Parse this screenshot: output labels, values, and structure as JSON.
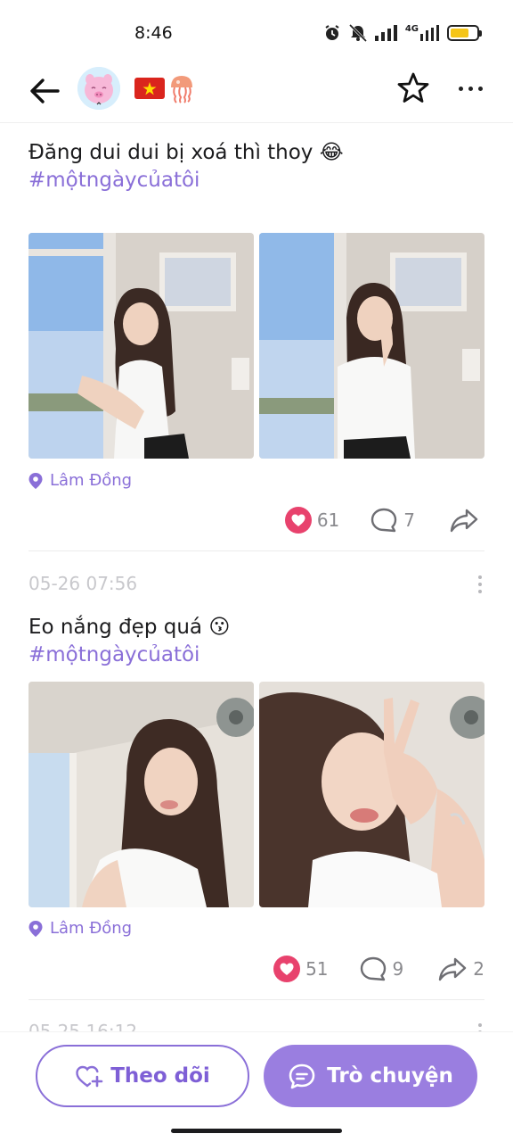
{
  "status_bar": {
    "time": "8:46",
    "network_label": "4G",
    "battery_level": 0.7,
    "icons": [
      "alarm-icon",
      "mute-icon",
      "signal-icon",
      "network-4g-icon",
      "battery-icon"
    ]
  },
  "header": {
    "back_icon": "arrow-left-icon",
    "avatar_icon": "pink-pig-avatar",
    "flag_icon": "vietnam-flag-icon",
    "badge_icon": "jellyfish-icon",
    "star_icon": "star-outline-icon",
    "more_icon": "more-horizontal-icon"
  },
  "posts": [
    {
      "date": "",
      "text": "Đăng dui dui bị xoá thì thoy 😂",
      "hashtag": "#mộtngàycủatôi",
      "photos": [
        "selfie-window-1",
        "selfie-window-2"
      ],
      "location": "Lâm Đồng",
      "likes": "61",
      "comments": "7",
      "shares": ""
    },
    {
      "date": "05-26 07:56",
      "text": "Eo nắng đẹp quá 😗",
      "hashtag": "#mộtngàycủatôi",
      "photos": [
        "selfie-fan-1",
        "selfie-fan-2"
      ],
      "location": "Lâm Đồng",
      "likes": "51",
      "comments": "9",
      "shares": "2"
    },
    {
      "date": "05-25 16:12"
    }
  ],
  "bottom_bar": {
    "follow_label": "Theo dõi",
    "chat_label": "Trò chuyện"
  },
  "colors": {
    "accent": "#8a6fd8",
    "chat_button": "#9a7ee0",
    "like": "#e8426d",
    "muted": "#8a8a8e"
  }
}
